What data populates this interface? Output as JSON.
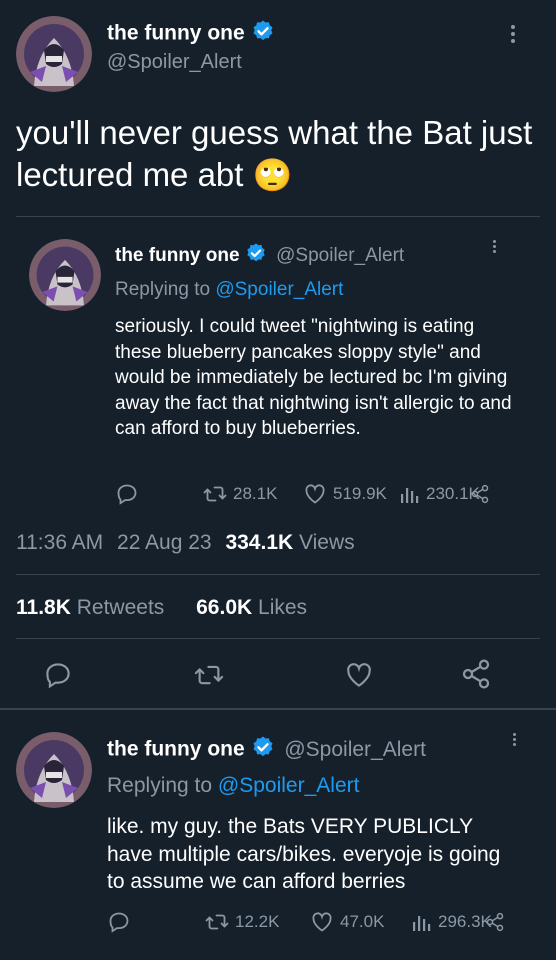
{
  "main_tweet": {
    "display_name": "the funny one",
    "handle": "@Spoiler_Alert",
    "text": "you'll never guess what the Bat just lectured me abt",
    "emoji": "🙄",
    "time": "11:36 AM",
    "date": "22 Aug 23",
    "views_count": "334.1K",
    "views_label": "Views",
    "retweets_count": "11.8K",
    "retweets_label": "Retweets",
    "likes_count": "66.0K",
    "likes_label": "Likes"
  },
  "quoted_reply": {
    "display_name": "the funny one",
    "handle": "@Spoiler_Alert",
    "replying_prefix": "Replying to",
    "replying_to": "@Spoiler_Alert",
    "text": "seriously. I could tweet \"nightwing is eating these blueberry pancakes sloppy style\" and would be immediately be lectured bc I'm giving away the fact that nightwing isn't allergic to and can afford to buy blueberries.",
    "retweets": "28.1K",
    "likes": "519.9K",
    "views": "230.1K"
  },
  "reply": {
    "display_name": "the funny one",
    "handle": "@Spoiler_Alert",
    "replying_prefix": "Replying to",
    "replying_to": "@Spoiler_Alert",
    "text": "like. my guy. the Bats VERY PUBLICLY have multiple cars/bikes. everyoje is going to assume we can afford berries",
    "retweets": "12.2K",
    "likes": "47.0K",
    "views": "296.3K"
  },
  "icons": [
    "verified-badge-icon",
    "more-icon",
    "reply-icon",
    "retweet-icon",
    "like-icon",
    "views-icon",
    "share-icon"
  ],
  "colors": {
    "background": "#15202b",
    "accent": "#1d9bf0",
    "muted": "#8b98a5",
    "divider": "#38444d"
  }
}
